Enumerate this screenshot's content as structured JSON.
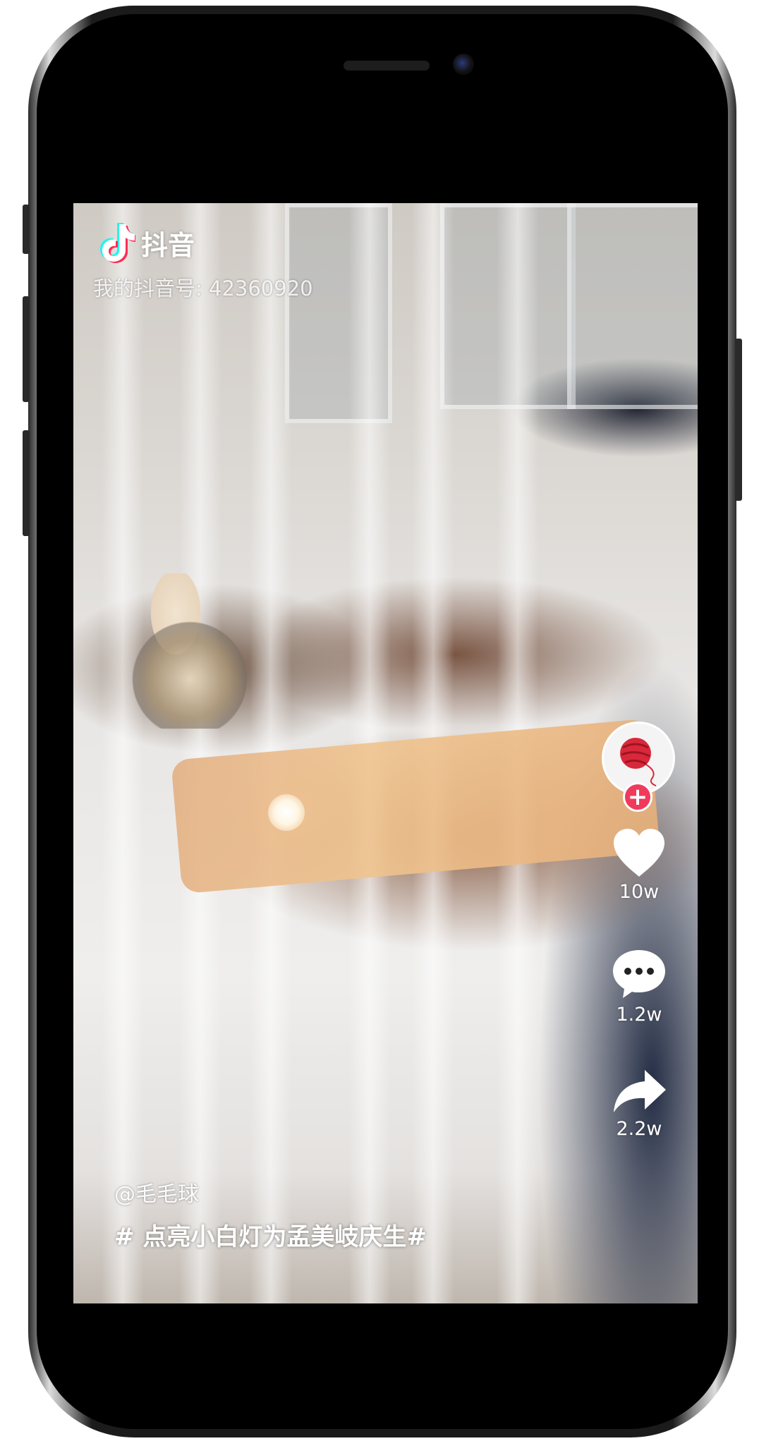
{
  "app": {
    "name": "抖音"
  },
  "video": {
    "account_id": "我的抖音号: 42360920",
    "username": "@毛毛球",
    "hashtag": "# 点亮小白灯为孟美岐庆生#"
  },
  "actions": {
    "likes": "10w",
    "comments": "1.2w",
    "shares": "2.2w",
    "follow_symbol": "+"
  },
  "icons": {
    "logo": "tiktok-note-icon",
    "like": "heart-icon",
    "comment": "comment-bubble-icon",
    "share": "share-arrow-icon",
    "avatar": "yarn-ball-avatar"
  },
  "colors": {
    "follow_badge": "#f03a5c",
    "logo_cyan": "#25f4ee",
    "logo_red": "#fe2c55",
    "avatar_yarn": "#d8283a"
  }
}
